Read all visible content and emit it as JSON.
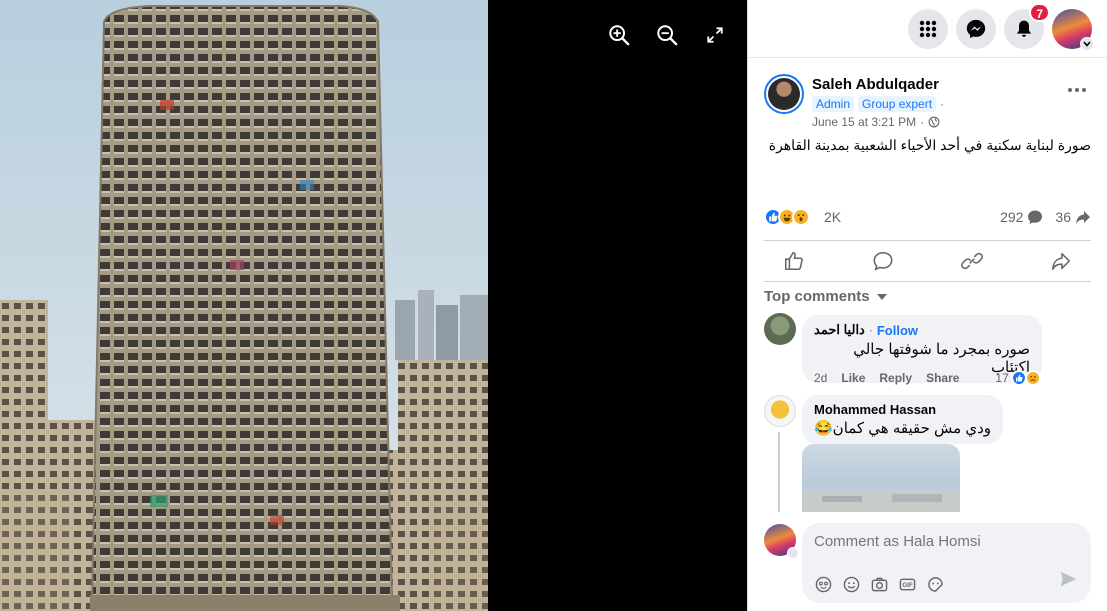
{
  "viewer": {
    "zoom_in_icon": "zoom-in-icon",
    "zoom_out_icon": "zoom-out-icon",
    "fullscreen_icon": "fullscreen-icon"
  },
  "topbar": {
    "notifications_count": "7"
  },
  "post": {
    "author": "Saleh Abdulqader",
    "tags": [
      "Admin",
      "Group expert"
    ],
    "timestamp": "June 15 at 3:21 PM",
    "separator": "·",
    "text": "صورة لبناية سكنية في أحد الأحياء الشعبية بمدينة القاهرة",
    "reactions_count": "2K",
    "comments_count": "292",
    "shares_count": "36"
  },
  "comments_header": "Top comments",
  "comments": [
    {
      "name": "داليا احمد",
      "follow": "Follow",
      "text": "صوره بمجرد ما شوفتها جالي اكتئاب",
      "time": "2d",
      "like": "Like",
      "reply": "Reply",
      "share": "Share",
      "reactions": "17"
    },
    {
      "name": "Mohammed Hassan",
      "text": "ودي مش حقيقه هي كمان😂"
    }
  ],
  "composer": {
    "placeholder": "Comment as Hala Homsi"
  },
  "colors": {
    "accent": "#1877f2",
    "badge": "#e41e3f"
  }
}
